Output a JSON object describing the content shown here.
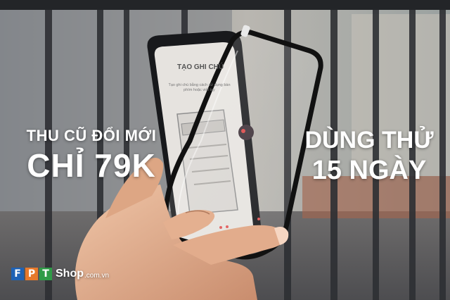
{
  "promo": {
    "left_line1": "THU CŨ ĐỔI MỚI",
    "left_line2": "CHỈ 79K",
    "right_line1": "DÙNG THỬ",
    "right_line2": "15 NGÀY"
  },
  "phone_screen": {
    "title": "TẠO GHI CHÚ",
    "body": "Tạo ghi chú bằng cách sử dụng bàn phím hoặc viết tay"
  },
  "logo": {
    "letters": [
      "F",
      "P",
      "T"
    ],
    "letter_colors": [
      "#1e62b5",
      "#e7792b",
      "#2f9b47"
    ],
    "brand": "Shop",
    "domain": ".com.vn"
  },
  "colors": {
    "phone_body": "#18191c",
    "screen_bg": "#e6e3df",
    "skin": "#e6b595",
    "background": "#7a7e83"
  }
}
